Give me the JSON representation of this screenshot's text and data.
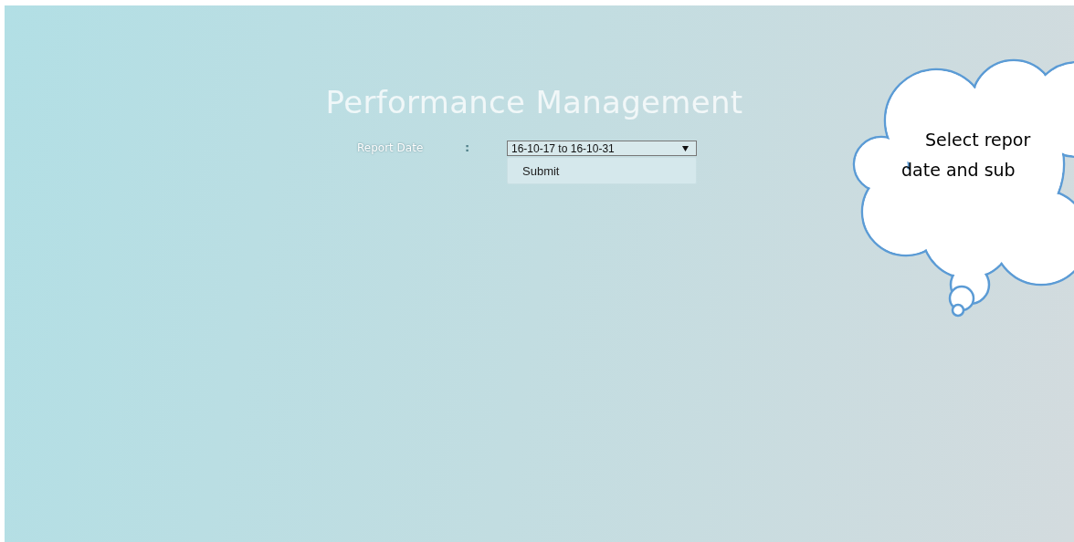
{
  "title": "Performance Management",
  "form": {
    "label": "Report Date",
    "separator": ":",
    "date_range": "16-10-17 to 16-10-31",
    "submit": "Submit"
  },
  "callout": {
    "lines": [
      "Select repor",
      "date and sub"
    ]
  }
}
